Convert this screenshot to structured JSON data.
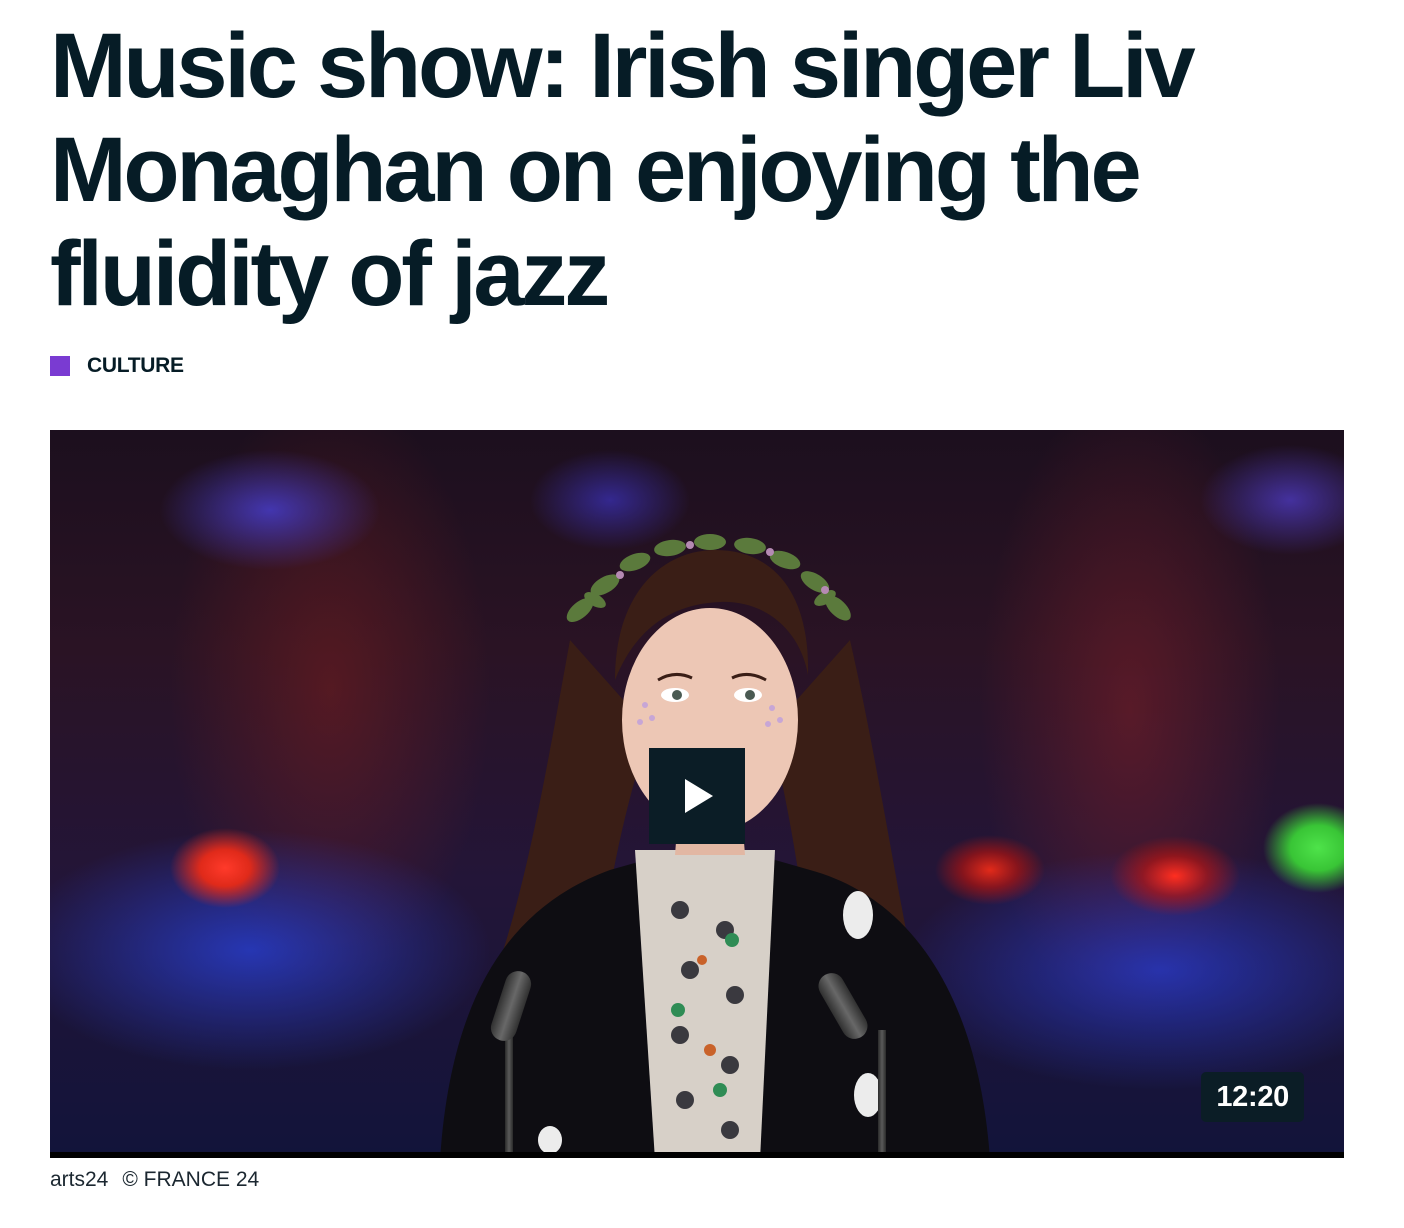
{
  "article": {
    "title": "Music show: Irish singer Liv Monaghan on enjoying the fluidity of jazz",
    "category": "CULTURE",
    "category_color": "#7a3bd2"
  },
  "video": {
    "duration": "12:20",
    "play_icon": "play-icon"
  },
  "caption": {
    "program": "arts24",
    "credit": "© FRANCE 24"
  }
}
